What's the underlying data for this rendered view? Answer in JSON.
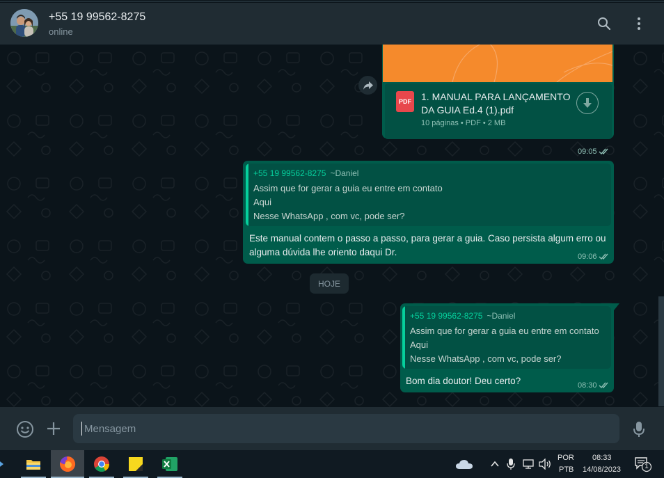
{
  "header": {
    "contact_name": "+55 19 99562-8275",
    "status": "online",
    "icons": [
      "search-icon",
      "menu-dots-icon"
    ]
  },
  "messages": {
    "document": {
      "file_name": "1. MANUAL PARA LANÇAMENTO DA GUIA Ed.4 (1).pdf",
      "file_name_line1": "1. MANUAL PARA LANÇAMENTO",
      "file_name_line2": "DA GUIA Ed.4 (1).pdf",
      "meta": "10 páginas • PDF • 2 MB",
      "icon_label": "PDF",
      "time": "09:05",
      "status": "read"
    },
    "reply1": {
      "quote_author": "+55 19 99562-8275",
      "quote_name": "~Daniel",
      "quote_lines": [
        "Assim que for gerar a guia eu entre em contato",
        "Aqui",
        "Nesse WhatsApp , com vc, pode ser?"
      ],
      "text_line1": "Este manual contem o passo a passo, para gerar a guia. Caso persista algum erro ou",
      "text_line2": "alguma dúvida lhe oriento daqui Dr.",
      "time": "09:06",
      "status": "read"
    },
    "date_chip": "HOJE",
    "reply2": {
      "quote_author": "+55 19 99562-8275",
      "quote_name": "~Daniel",
      "quote_lines": [
        "Assim que for gerar a guia eu entre em contato",
        "Aqui",
        "Nesse WhatsApp , com vc, pode ser?"
      ],
      "text": "Bom dia doutor! Deu certo?",
      "time": "08:30",
      "status": "read"
    }
  },
  "composer": {
    "placeholder": "Mensagem",
    "icons": [
      "emoji-icon",
      "plus-icon",
      "microphone-icon"
    ]
  },
  "taskbar": {
    "apps": [
      "file-explorer",
      "firefox",
      "chrome",
      "sticky-notes",
      "excel"
    ],
    "active_app": "firefox",
    "tray": {
      "lang_top": "POR",
      "lang_bottom": "PTB",
      "time": "08:33",
      "date": "14/08/2023",
      "notifications": "1"
    }
  },
  "colors": {
    "outgoing_bubble": "#005c4b",
    "header": "#202c33",
    "background": "#0b141a",
    "accent": "#06cf9c",
    "pdf": "#e8474c",
    "doc_thumb": "#f58a2c"
  }
}
